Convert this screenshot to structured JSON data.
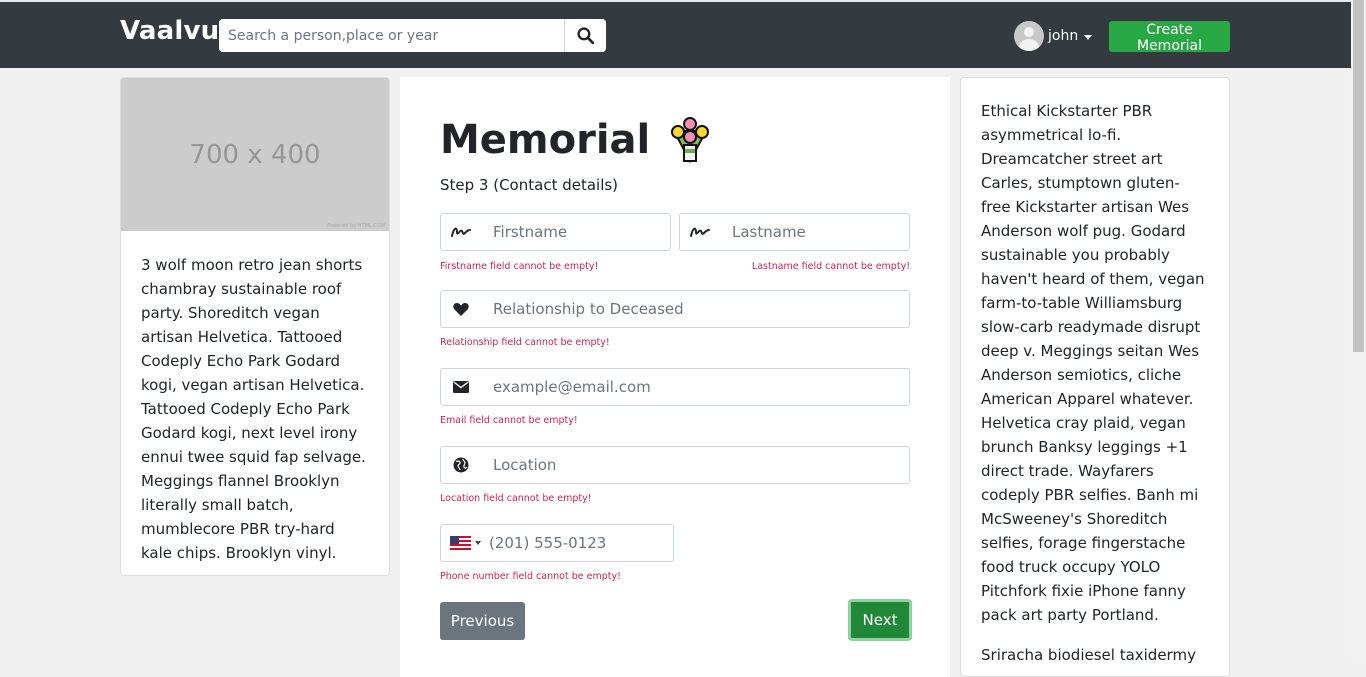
{
  "header": {
    "brand": "Vaalvu",
    "search_placeholder": "Search a person,place or year",
    "user_name": "john",
    "create_button": "Create Memorial"
  },
  "left_card": {
    "image_label": "700 x 400",
    "image_credit": "Powered by HTML.COM",
    "text": "3 wolf moon retro jean shorts chambray sustainable roof party. Shoreditch vegan artisan Helvetica. Tattooed Codeply Echo Park Godard kogi, vegan artisan Helvetica. Tattooed Codeply Echo Park Godard kogi, next level irony ennui twee squid fap selvage. Meggings flannel Brooklyn literally small batch, mumblecore PBR try-hard kale chips. Brooklyn vinyl."
  },
  "form": {
    "title": "Memorial",
    "step": "Step 3 (Contact details)",
    "firstname_placeholder": "Firstname",
    "firstname_error": "Firstname field cannot be empty!",
    "lastname_placeholder": "Lastname",
    "lastname_error": "Lastname field cannot be empty!",
    "relationship_placeholder": "Relationship to Deceased",
    "relationship_error": "Relationship field cannot be empty!",
    "email_placeholder": "example@email.com",
    "email_error": "Email field cannot be empty!",
    "location_placeholder": "Location",
    "location_error": "Location field cannot be empty!",
    "phone_placeholder": "(201) 555-0123",
    "phone_error": "Phone number field cannot be empty!",
    "previous_button": "Previous",
    "next_button": "Next"
  },
  "right_card": {
    "paragraph1": "Ethical Kickstarter PBR asymmetrical lo-fi. Dreamcatcher street art Carles, stumptown gluten-free Kickstarter artisan Wes Anderson wolf pug. Godard sustainable you probably haven't heard of them, vegan farm-to-table Williamsburg slow-carb readymade disrupt deep v. Meggings seitan Wes Anderson semiotics, cliche American Apparel whatever. Helvetica cray plaid, vegan brunch Banksy leggings +1 direct trade. Wayfarers codeply PBR selfies. Banh mi McSweeney's Shoreditch selfies, forage fingerstache food truck occupy YOLO Pitchfork fixie iPhone fanny pack art party Portland.",
    "paragraph2": "Sriracha biodiesel taxidermy"
  },
  "colors": {
    "navbar": "#343a40",
    "create_button": "#28a745",
    "next_button": "#218838",
    "previous_button": "#6c757d",
    "error_text": "#c0294f"
  }
}
